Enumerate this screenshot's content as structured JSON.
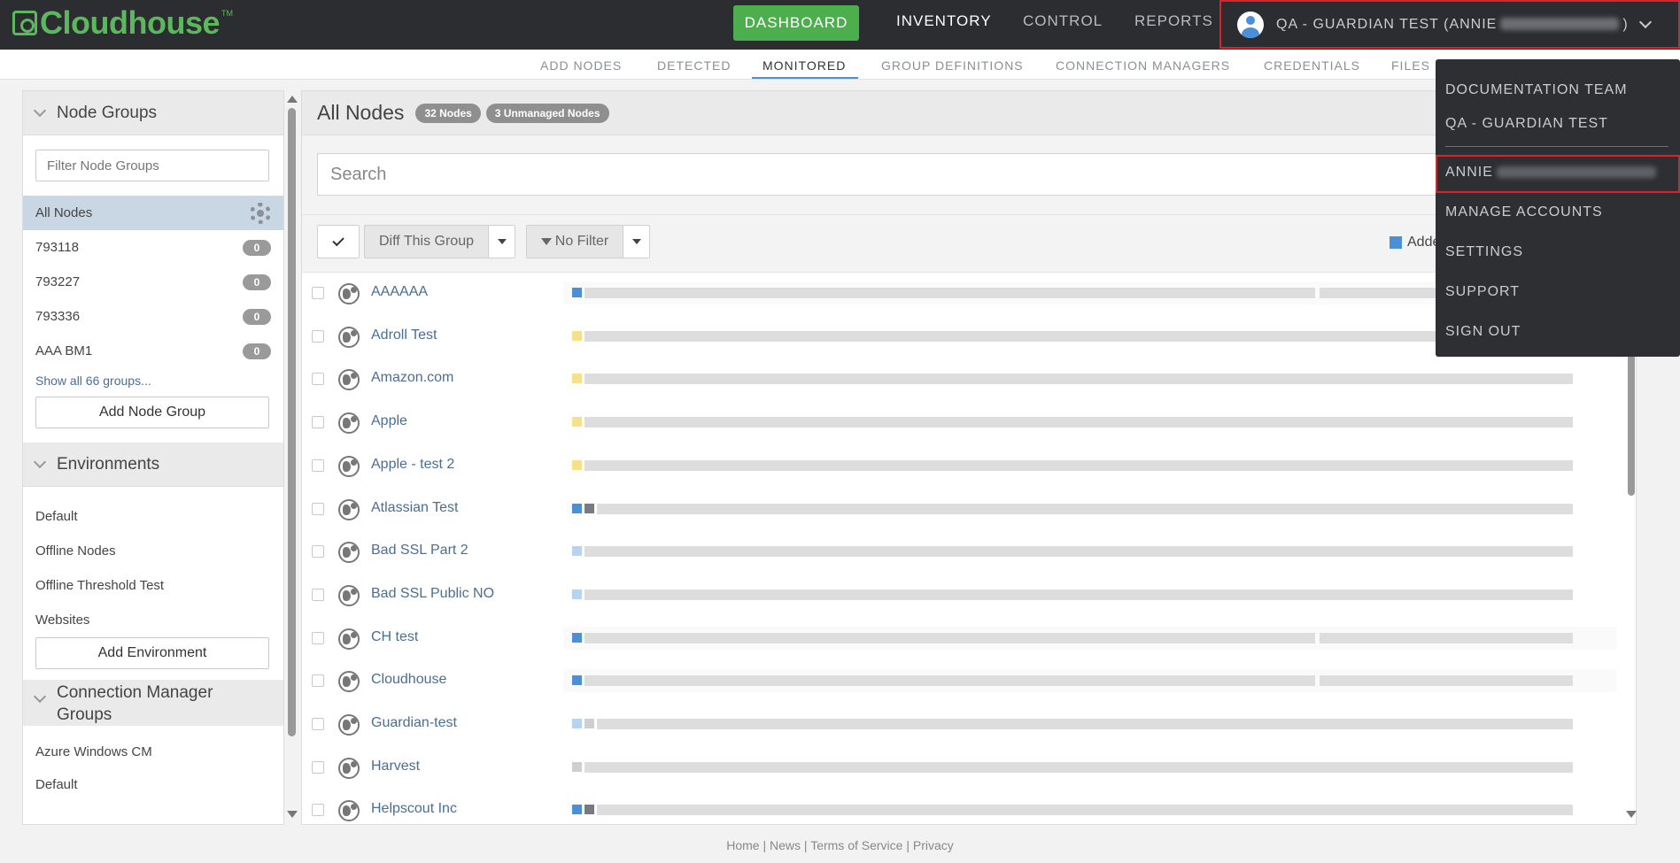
{
  "brand": {
    "name": "Cloudhouse",
    "tm": "TM",
    "color": "#5cb85c"
  },
  "topnav": {
    "dashboard": "DASHBOARD",
    "inventory": "INVENTORY",
    "control": "CONTROL",
    "reports": "REPORTS",
    "account_label": "QA - GUARDIAN TEST (ANNIE",
    "account_suffix": ")"
  },
  "subnav": [
    "ADD NODES",
    "DETECTED",
    "MONITORED",
    "GROUP DEFINITIONS",
    "CONNECTION MANAGERS",
    "CREDENTIALS",
    "FILES"
  ],
  "sidebar": {
    "node_groups_title": "Node Groups",
    "filter_placeholder": "Filter Node Groups",
    "groups": [
      {
        "name": "All Nodes"
      },
      {
        "name": "793118",
        "count": "0"
      },
      {
        "name": "793227",
        "count": "0"
      },
      {
        "name": "793336",
        "count": "0"
      },
      {
        "name": "AAA BM1",
        "count": "0"
      }
    ],
    "show_all": "Show all 66 groups...",
    "add_node_group": "Add Node Group",
    "environments_title": "Environments",
    "environments": [
      "Default",
      "Offline Nodes",
      "Offline Threshold Test",
      "Websites"
    ],
    "add_environment": "Add Environment",
    "cm_groups_title": "Connection Manager Groups",
    "cm_groups": [
      "Azure Windows CM",
      "Default"
    ]
  },
  "main": {
    "title": "All Nodes",
    "nodes_badge": "32 Nodes",
    "unmanaged_badge": "3 Unmanaged Nodes",
    "search_placeholder": "Search",
    "diff_button": "Diff This Group",
    "filter_button": "No Filter",
    "legend_added": "Adde",
    "nodes": [
      {
        "name": "AAAAAA",
        "status": [
          "#4a90d9"
        ],
        "wide": true
      },
      {
        "name": "Adroll Test",
        "status": [
          "#f7e08a"
        ],
        "wide": false
      },
      {
        "name": "Amazon.com",
        "status": [
          "#f7e08a"
        ],
        "wide": false
      },
      {
        "name": "Apple",
        "status": [
          "#f7e08a"
        ],
        "wide": false
      },
      {
        "name": "Apple - test 2",
        "status": [
          "#f7e08a"
        ],
        "wide": false
      },
      {
        "name": "Atlassian Test",
        "status": [
          "#4a90d9",
          "#777b80"
        ],
        "wide": false
      },
      {
        "name": "Bad SSL Part 2",
        "status": [
          "#b7d3f2"
        ],
        "wide": false
      },
      {
        "name": "Bad SSL Public NO",
        "status": [
          "#b7d3f2"
        ],
        "wide": false
      },
      {
        "name": "CH test",
        "status": [
          "#4a90d9"
        ],
        "wide": true
      },
      {
        "name": "Cloudhouse",
        "status": [
          "#4a90d9"
        ],
        "wide": true
      },
      {
        "name": "Guardian-test",
        "status": [
          "#b7d3f2",
          "#cfcfcf"
        ],
        "wide": false
      },
      {
        "name": "Harvest",
        "status": [
          "#cfcfcf"
        ],
        "wide": false
      },
      {
        "name": "Helpscout Inc",
        "status": [
          "#4a90d9",
          "#777b80"
        ],
        "wide": false
      }
    ]
  },
  "dropdown": {
    "items": [
      "DOCUMENTATION TEAM",
      "QA - GUARDIAN TEST",
      "ANNIE",
      "MANAGE ACCOUNTS",
      "SETTINGS",
      "SUPPORT",
      "SIGN OUT"
    ]
  },
  "footer": {
    "home": "Home",
    "news": "News",
    "terms": "Terms of Service",
    "privacy": "Privacy",
    "sep": "|"
  },
  "colors": {
    "accent": "#4a90d9",
    "danger": "#d9232a",
    "navbar": "#2b2d31"
  }
}
